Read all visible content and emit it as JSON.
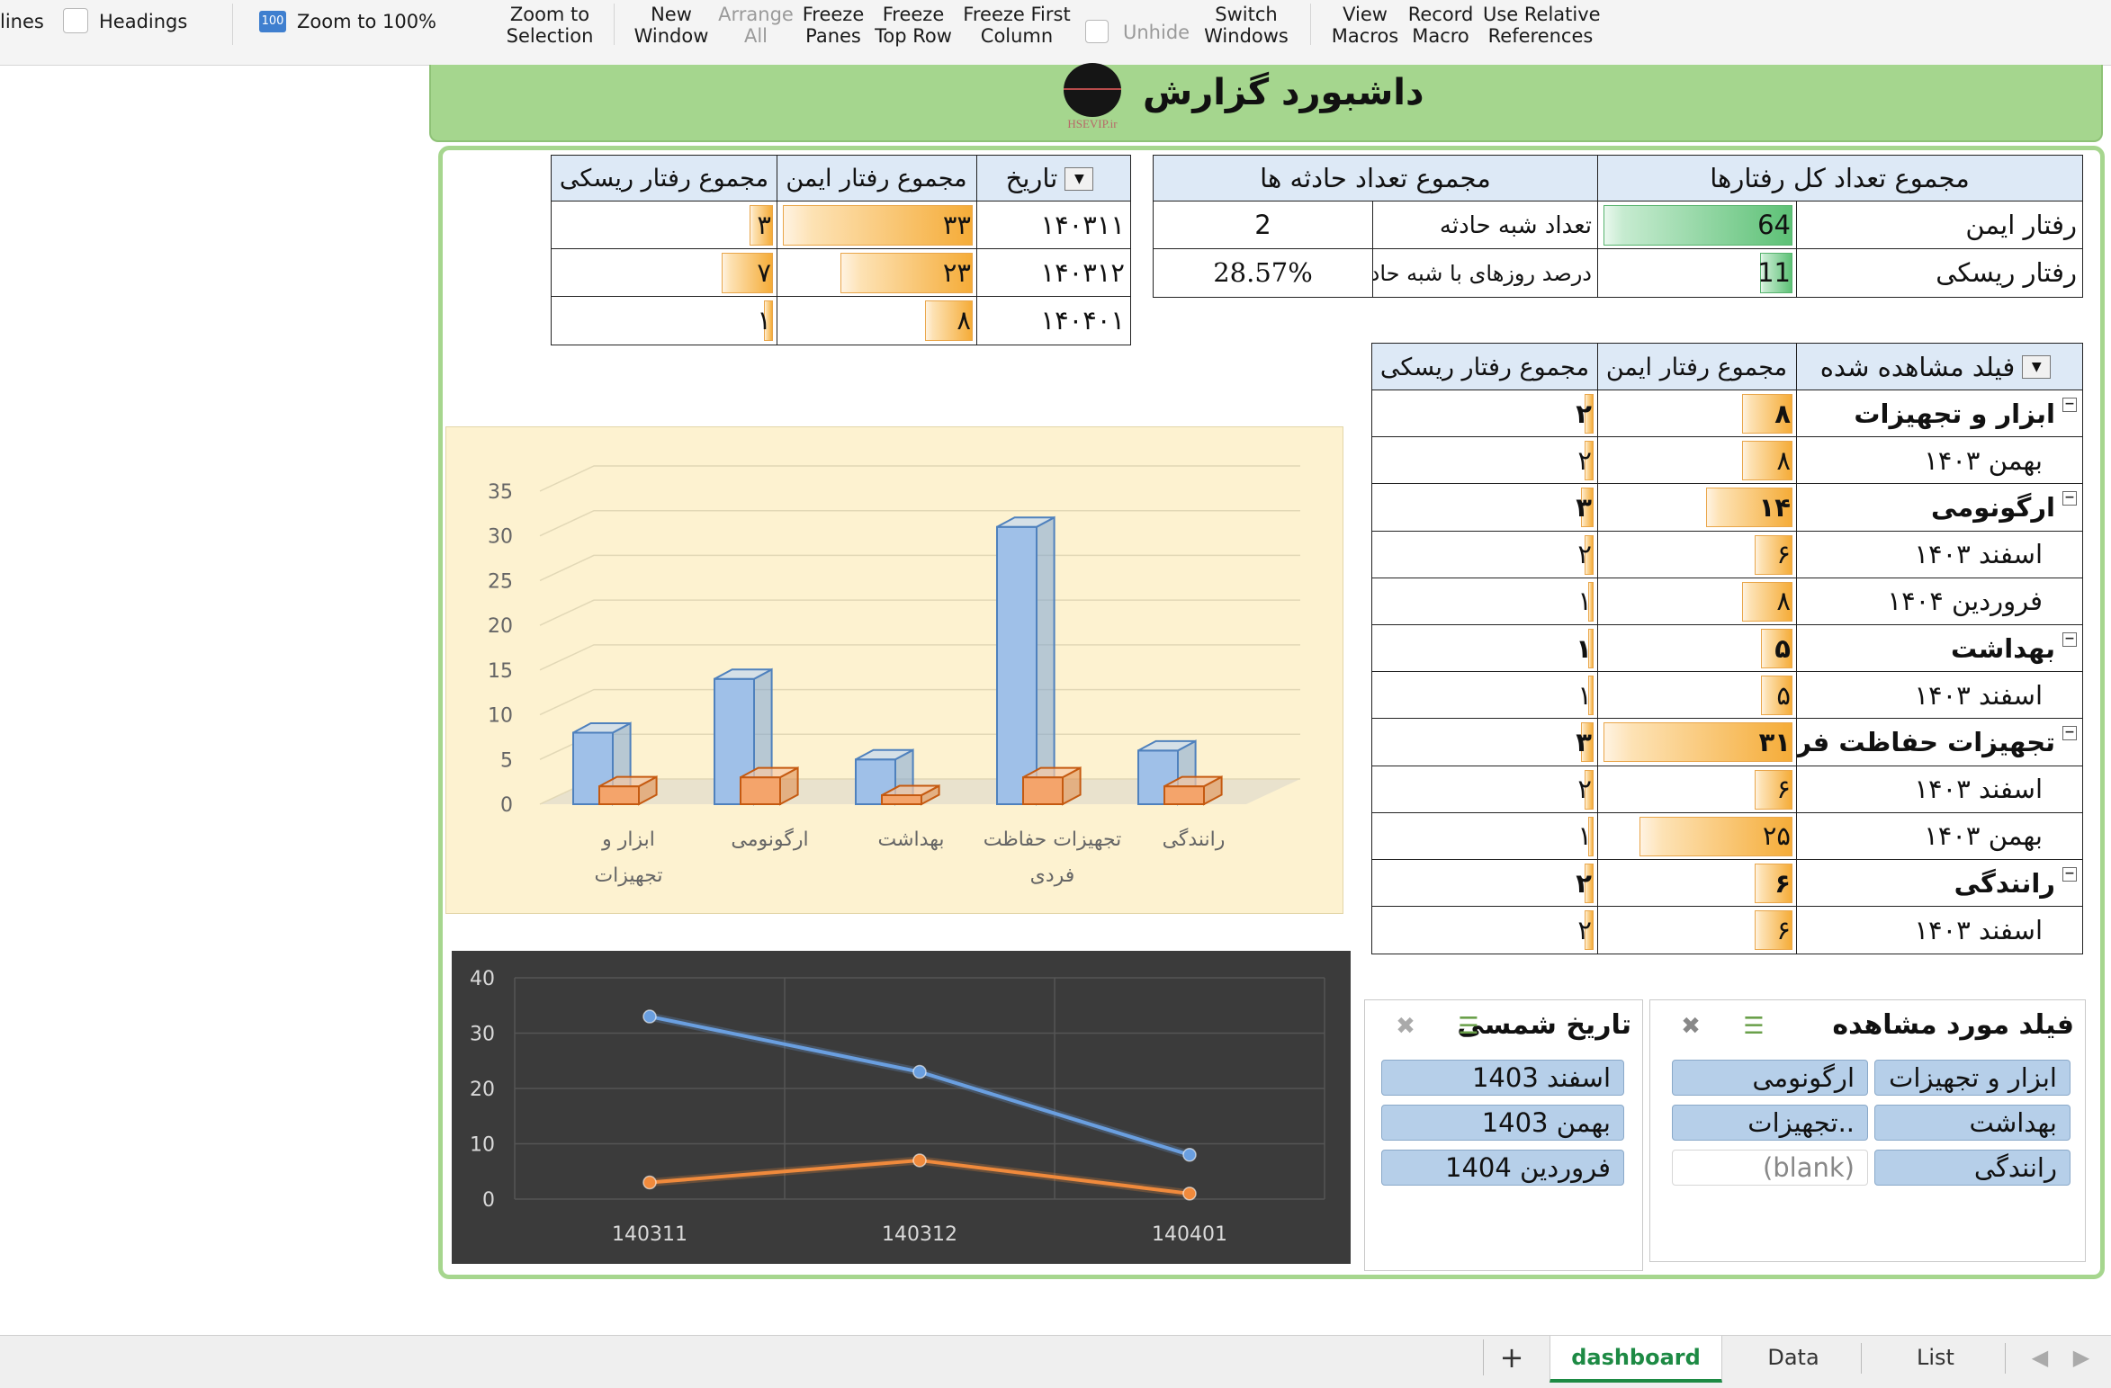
{
  "ribbon": {
    "gridlines_label": "lines",
    "headings_label": "Headings",
    "zoom100_label": "Zoom to 100%",
    "zoom100_badge": "100",
    "zoom_selection": [
      "Zoom to",
      "Selection"
    ],
    "new_window": [
      "New",
      "Window"
    ],
    "arrange_all": [
      "Arrange",
      "All"
    ],
    "freeze_panes": [
      "Freeze",
      "Panes"
    ],
    "freeze_top_row": [
      "Freeze",
      "Top Row"
    ],
    "freeze_first_column": [
      "Freeze First",
      "Column"
    ],
    "unhide": "Unhide",
    "switch_windows": [
      "Switch",
      "Windows"
    ],
    "view_macros": [
      "View",
      "Macros"
    ],
    "record_macro": [
      "Record",
      "Macro"
    ],
    "use_relative": [
      "Use Relative",
      "References"
    ]
  },
  "banner": {
    "title": "داشبورد گزارش",
    "logo_text": "HSEVIP.ir"
  },
  "summary": {
    "h_total": "مجموع تعداد کل رفتارها",
    "h_incidents": "مجموع تعداد حادثه ها",
    "safe_label": "رفتار ایمن",
    "safe_value": "64",
    "safe_fill": 1.0,
    "risky_label": "رفتار ریسکی",
    "risky_value": "11",
    "risky_fill": 0.17,
    "near_miss_label": "تعداد شبه حادثه",
    "near_miss_value": "2",
    "pct_label": "درصد روزهای با شبه حاد",
    "pct_value": "28.57%"
  },
  "date_table": {
    "h_date": "تاریخ",
    "h_safe": "مجموع رفتار ایمن",
    "h_risky": "مجموع رفتار ریسکی",
    "rows": [
      {
        "date": "۱۴۰۳۱۱",
        "safe": "۳۳",
        "safe_v": 33,
        "risky": "۳",
        "risky_v": 3
      },
      {
        "date": "۱۴۰۳۱۲",
        "safe": "۲۳",
        "safe_v": 23,
        "risky": "۷",
        "risky_v": 7
      },
      {
        "date": "۱۴۰۴۰۱",
        "safe": "۸",
        "safe_v": 8,
        "risky": "۱",
        "risky_v": 1
      }
    ]
  },
  "field_table": {
    "h_field": "فیلد مشاهده شده",
    "h_safe": "مجموع رفتار ایمن",
    "h_risky": "مجموع رفتار ریسکی",
    "rows": [
      {
        "label": "ابزار و تجهیزات",
        "group": true,
        "safe": "۸",
        "safe_v": 8,
        "risky": "۲",
        "risky_v": 2
      },
      {
        "label": "بهمن ۱۴۰۳",
        "group": false,
        "safe": "۸",
        "safe_v": 8,
        "risky": "۲",
        "risky_v": 2
      },
      {
        "label": "ارگونومی",
        "group": true,
        "safe": "۱۴",
        "safe_v": 14,
        "risky": "۳",
        "risky_v": 3
      },
      {
        "label": "اسفند ۱۴۰۳",
        "group": false,
        "safe": "۶",
        "safe_v": 6,
        "risky": "۲",
        "risky_v": 2
      },
      {
        "label": "فروردین ۱۴۰۴",
        "group": false,
        "safe": "۸",
        "safe_v": 8,
        "risky": "۱",
        "risky_v": 1
      },
      {
        "label": "بهداشت",
        "group": true,
        "safe": "۵",
        "safe_v": 5,
        "risky": "۱",
        "risky_v": 1
      },
      {
        "label": "اسفند ۱۴۰۳",
        "group": false,
        "safe": "۵",
        "safe_v": 5,
        "risky": "۱",
        "risky_v": 1
      },
      {
        "label": "تجهیزات حفاظت فردی",
        "group": true,
        "safe": "۳۱",
        "safe_v": 31,
        "risky": "۳",
        "risky_v": 3
      },
      {
        "label": "اسفند ۱۴۰۳",
        "group": false,
        "safe": "۶",
        "safe_v": 6,
        "risky": "۲",
        "risky_v": 2
      },
      {
        "label": "بهمن ۱۴۰۳",
        "group": false,
        "safe": "۲۵",
        "safe_v": 25,
        "risky": "۱",
        "risky_v": 1
      },
      {
        "label": "رانندگی",
        "group": true,
        "safe": "۶",
        "safe_v": 6,
        "risky": "۲",
        "risky_v": 2
      },
      {
        "label": "اسفند ۱۴۰۳",
        "group": false,
        "safe": "۶",
        "safe_v": 6,
        "risky": "۲",
        "risky_v": 2
      }
    ]
  },
  "slicers": {
    "field": {
      "title": "فیلد مورد مشاهده",
      "items": [
        "ابزار و تجهیزات",
        "ارگونومی",
        "بهداشت",
        "تجهیزات..",
        "رانندگی",
        "(blank)"
      ]
    },
    "date": {
      "title": "تاریخ شمسی",
      "items": [
        "اسفند 1403",
        "بهمن 1403",
        "فروردین 1404"
      ]
    }
  },
  "tabs": {
    "add": "+",
    "items": [
      "dashboard",
      "Data",
      "List"
    ],
    "active": "dashboard"
  },
  "chart_data": [
    {
      "type": "bar",
      "categories": [
        "ابزار و تجهیزات",
        "ارگونومی",
        "بهداشت",
        "تجهیزات حفاظت فردی",
        "رانندگی"
      ],
      "series": [
        {
          "values": [
            8,
            14,
            5,
            31,
            6
          ],
          "color": "#9ec0e6"
        },
        {
          "values": [
            2,
            3,
            1,
            3,
            2
          ],
          "color": "#f2a46c"
        }
      ],
      "ylim": [
        0,
        35
      ],
      "yticks": [
        0,
        5,
        10,
        15,
        20,
        25,
        30,
        35
      ],
      "style": "3d-clustered-column",
      "background": "#fdf2d0"
    },
    {
      "type": "line",
      "x": [
        "140311",
        "140312",
        "140401"
      ],
      "series": [
        {
          "values": [
            33,
            23,
            8
          ],
          "color": "#6a9fe0"
        },
        {
          "values": [
            3,
            7,
            1
          ],
          "color": "#f08a3c"
        }
      ],
      "ylim": [
        0,
        40
      ],
      "yticks": [
        0,
        10,
        20,
        30,
        40
      ],
      "background": "#3b3b3b"
    }
  ]
}
